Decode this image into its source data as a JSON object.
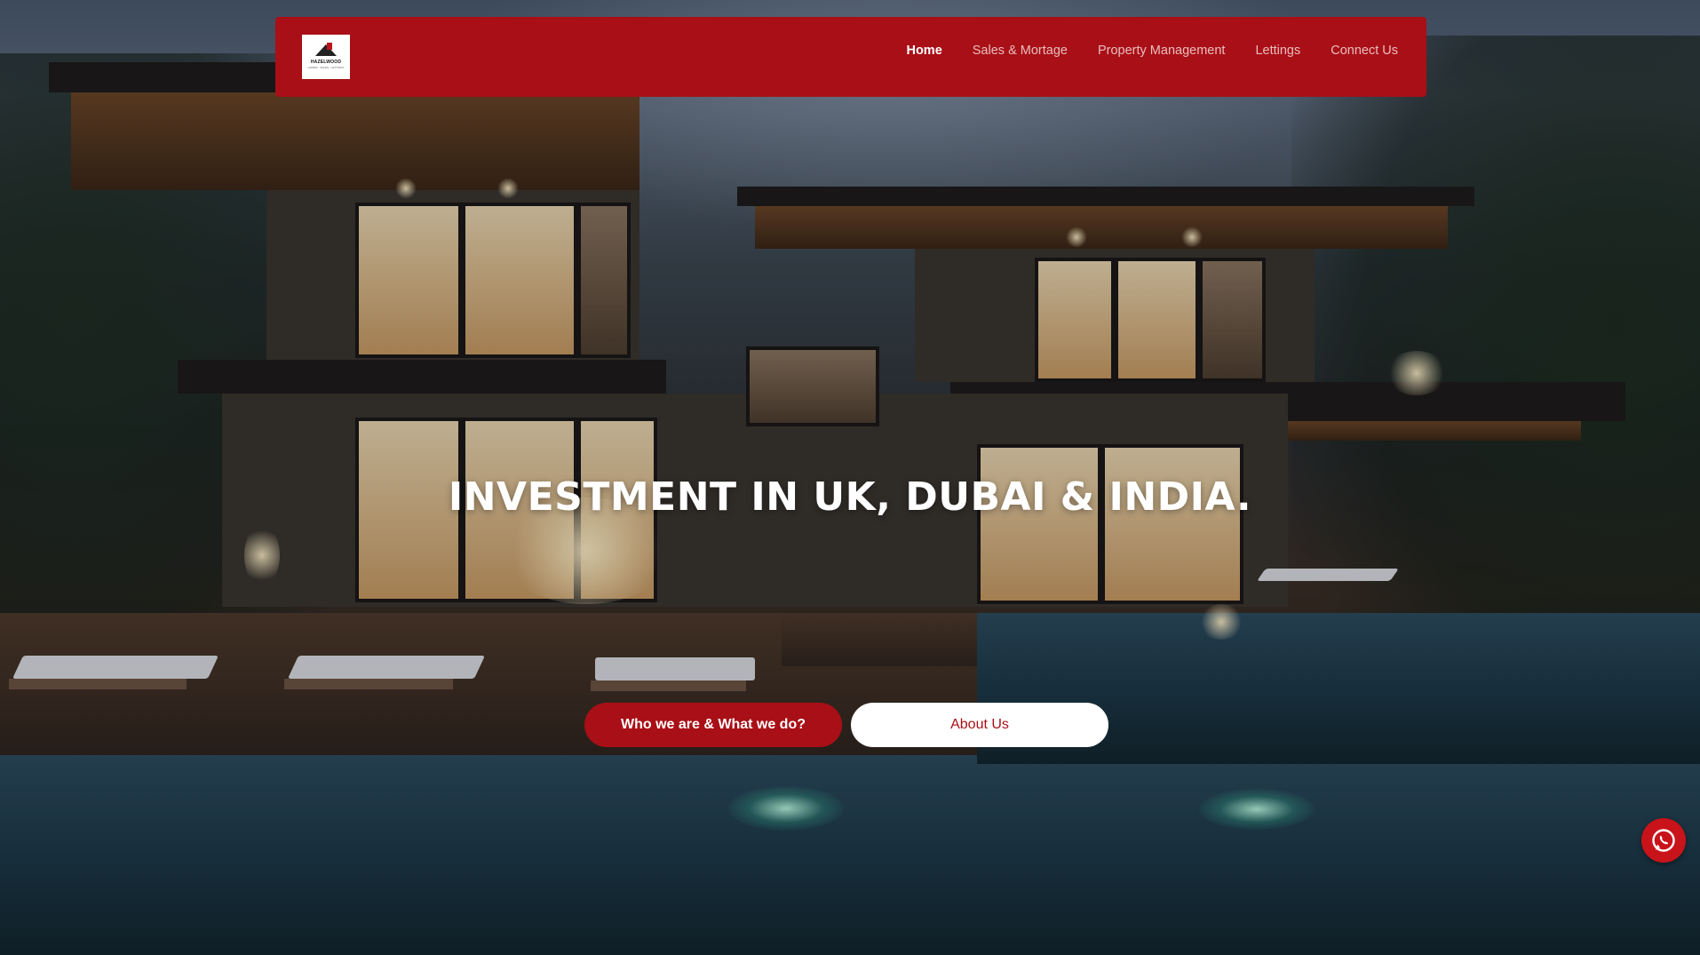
{
  "brand": {
    "logo_text": "HAZELWOOD",
    "logo_sub": "HOMES · SALES · LETTINGS"
  },
  "nav": {
    "items": [
      {
        "label": "Home",
        "active": true
      },
      {
        "label": "Sales & Mortage",
        "active": false
      },
      {
        "label": "Property Management",
        "active": false
      },
      {
        "label": "Lettings",
        "active": false
      },
      {
        "label": "Connect Us",
        "active": false
      }
    ]
  },
  "hero": {
    "headline": "INVESTMENT IN UK, DUBAI & INDIA.",
    "primary_button": "Who we are & What we do?",
    "secondary_button": "About Us"
  },
  "icons": {
    "floating": "whatsapp-icon",
    "logo": "house-roof-icon"
  },
  "colors": {
    "brand_red": "#a90f16",
    "text_light": "#ffffff",
    "button_alt_bg": "#ffffff"
  }
}
